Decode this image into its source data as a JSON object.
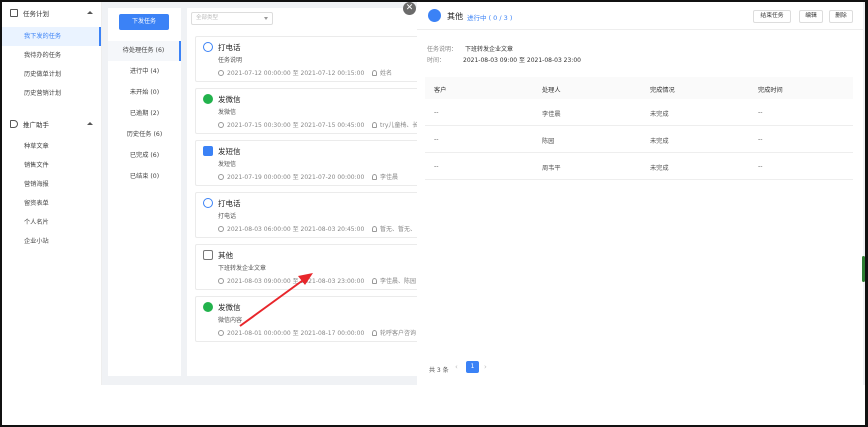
{
  "sidebar": {
    "group1": {
      "label": "任务计划"
    },
    "group1_items": [
      {
        "label": "我下发的任务",
        "active": true
      },
      {
        "label": "我待办的任务",
        "active": false
      },
      {
        "label": "历史做单计划",
        "active": false
      },
      {
        "label": "历史营销计划",
        "active": false
      }
    ],
    "group2": {
      "label": "推广助手"
    },
    "group2_items": [
      {
        "label": "种草文章"
      },
      {
        "label": "销售文件"
      },
      {
        "label": "营销海报"
      },
      {
        "label": "留资表单"
      },
      {
        "label": "个人名片"
      },
      {
        "label": "企业小站"
      }
    ]
  },
  "filters": {
    "issue_button": "下发任务",
    "items": [
      {
        "label": "待处理任务 (6)",
        "active": true
      },
      {
        "label": "进行中 (4)"
      },
      {
        "label": "未开始 (0)"
      },
      {
        "label": "已逾期 (2)"
      },
      {
        "label": "历史任务 (6)"
      },
      {
        "label": "已完成 (6)"
      },
      {
        "label": "已结束 (0)"
      }
    ]
  },
  "task_list": {
    "type_select_placeholder": "全部类型",
    "cards": [
      {
        "icon": "phone-icon",
        "title": "打电话",
        "subtitle": "任务说明",
        "time": "2021-07-12 00:00:00 至 2021-07-12 00:15:00",
        "assignees": "姓名"
      },
      {
        "icon": "wechat-icon",
        "title": "发微信",
        "subtitle": "发微信",
        "time": "2021-07-15 00:30:00 至 2021-07-15 00:45:00",
        "assignees": "try儿童椅、长"
      },
      {
        "icon": "sms-icon",
        "title": "发短信",
        "subtitle": "发短信",
        "time": "2021-07-19 00:00:00 至 2021-07-20 00:00:00",
        "assignees": "李佳晨"
      },
      {
        "icon": "phone-icon",
        "title": "打电话",
        "subtitle": "打电话",
        "time": "2021-08-03 06:00:00 至 2021-08-03 20:45:00",
        "assignees": "暂无、暂无、"
      },
      {
        "icon": "other-icon",
        "title": "其他",
        "subtitle": "下班转发企业文章",
        "time": "2021-08-03 09:00:00 至 2021-08-03 23:00:00",
        "assignees": "李佳晨、陈园"
      },
      {
        "icon": "wechat-icon",
        "title": "发微信",
        "subtitle": "微信内容",
        "time": "2021-08-01 00:00:00 至 2021-08-17 00:00:00",
        "assignees": "轮呼客户咨询"
      }
    ]
  },
  "detail": {
    "title": "其他",
    "status": "进行中 ( 0 / 3 )",
    "buttons": {
      "end_task": "结束任务",
      "edit": "编辑",
      "delete": "删除"
    },
    "desc_label": "任务说明：",
    "desc_value": "下班转发企业文章",
    "time_label": "时间：",
    "time_value": "2021-08-03 09:00 至 2021-08-03 23:00",
    "columns": [
      "客户",
      "处理人",
      "完成情况",
      "完成时间"
    ],
    "rows": [
      [
        "--",
        "李佳晨",
        "未完成",
        "--"
      ],
      [
        "--",
        "陈园",
        "未完成",
        "--"
      ],
      [
        "--",
        "周韦平",
        "未完成",
        "--"
      ]
    ],
    "pager": {
      "total": "共 3 条",
      "current": "1",
      "prev": "‹",
      "next": "›"
    }
  },
  "close_label": "✕"
}
